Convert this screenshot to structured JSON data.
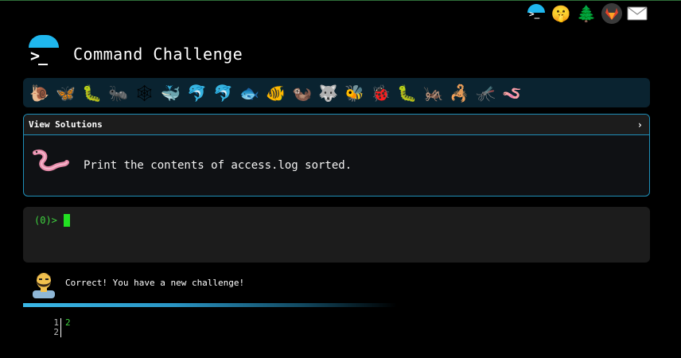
{
  "header": {
    "title": "Command Challenge",
    "logo_prompt": ">_",
    "icons": [
      "cmdchallenge-icon",
      "shushing-face-icon",
      "tree-icon",
      "gitlab-icon",
      "envelope-icon"
    ]
  },
  "animals": [
    "🐌",
    "🦋",
    "🐛",
    "🐜",
    "🕸",
    "🐳",
    "🐬",
    "🐬",
    "🐟",
    "🐠",
    "🦦",
    "🐺",
    "🐝",
    "🐞",
    "🐛",
    "🦗",
    "🦂",
    "🦟",
    "🪱"
  ],
  "animal_names": [
    "snail",
    "butterfly",
    "caterpillar",
    "ant",
    "spiderweb",
    "whale",
    "dolphin",
    "dolphin-grey",
    "fish",
    "tropical-fish",
    "otter",
    "wolf",
    "bee",
    "ladybug",
    "bug",
    "cricket",
    "scorpion",
    "mosquito",
    "worm"
  ],
  "solutions": {
    "label": "View Solutions",
    "chevron": "›",
    "challenge": "Print the contents of access.log sorted."
  },
  "terminal": {
    "prompt": "(0)>"
  },
  "feedback": {
    "message": "Correct! You have a new challenge!"
  },
  "output": {
    "line_numbers": [
      "1",
      "2"
    ],
    "lines": [
      "2"
    ]
  }
}
